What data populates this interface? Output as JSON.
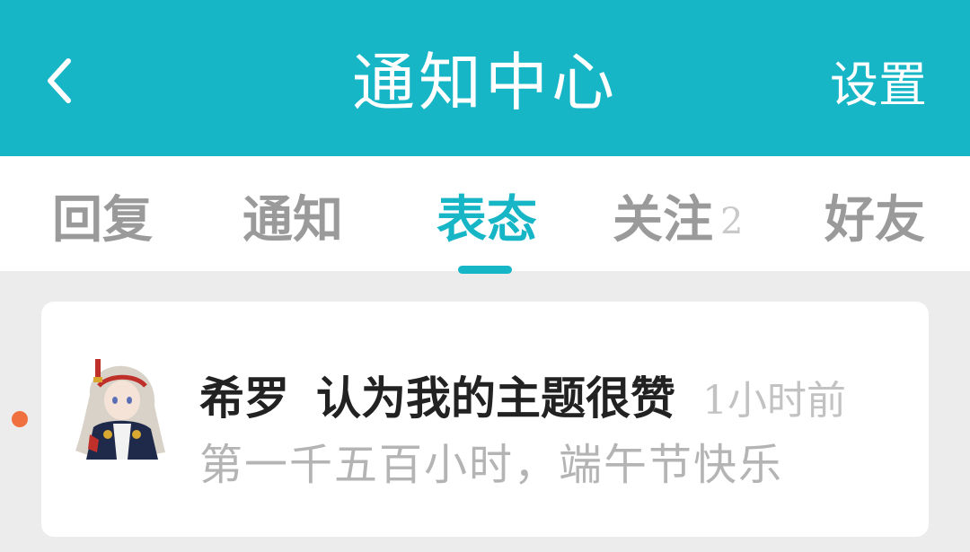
{
  "header": {
    "title": "通知中心",
    "settings_label": "设置",
    "back_icon": "chevron-left-icon"
  },
  "tabs": [
    {
      "label": "回复",
      "active": false
    },
    {
      "label": "通知",
      "active": false
    },
    {
      "label": "表态",
      "active": true
    },
    {
      "label": "关注",
      "badge": "2",
      "active": false
    },
    {
      "label": "好友",
      "active": false
    }
  ],
  "notifications": [
    {
      "user": "希罗",
      "action": "认为我的主题很赞",
      "time": "1小时前",
      "content": "第一千五百小时，端午节快乐",
      "unread": true
    }
  ],
  "colors": {
    "accent": "#17b6c7",
    "background": "#ececec",
    "unread_dot": "#f07040",
    "tab_inactive": "#9a9a9a"
  }
}
